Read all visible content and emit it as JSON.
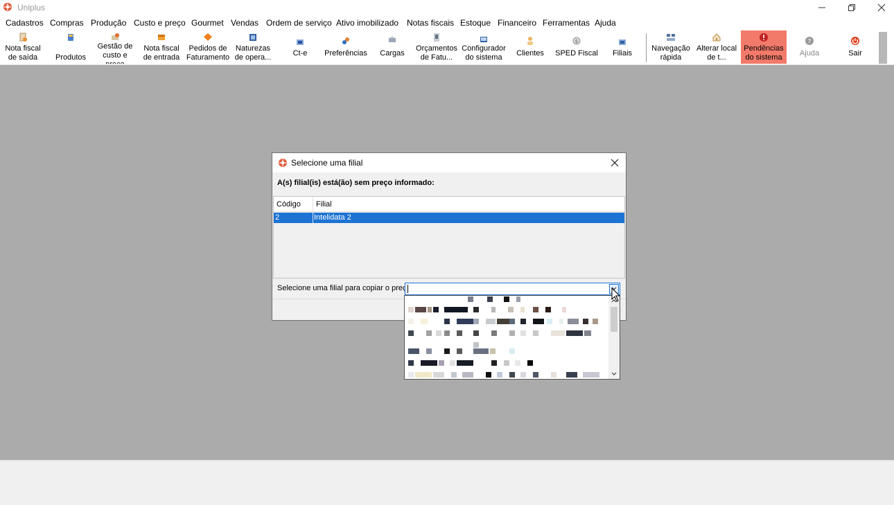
{
  "window": {
    "title": "Uniplus",
    "logo_icon": "uniplus-logo-icon",
    "controls": [
      "minimize-icon",
      "restore-icon",
      "close-icon"
    ]
  },
  "menu": [
    "Cadastros",
    "Compras",
    "Produção",
    "Custo e preço",
    "Gourmet",
    "Vendas",
    "Ordem de serviço",
    "Ativo imobilizado",
    "Notas fiscais",
    "Estoque",
    "Financeiro",
    "Ferramentas",
    "Ajuda"
  ],
  "toolbar": [
    {
      "label": "Nota fiscal\nde saída",
      "icon": "invoice-out-icon"
    },
    {
      "label": "Produtos",
      "icon": "products-icon"
    },
    {
      "label": "Gestão de\ncusto e\npreço",
      "icon": "cost-price-icon"
    },
    {
      "label": "Nota fiscal\nde entrada",
      "icon": "invoice-in-icon"
    },
    {
      "label": "Pedidos de\nFaturamento",
      "icon": "billing-orders-icon"
    },
    {
      "label": "Naturezas\nde opera...",
      "icon": "operation-natures-icon"
    },
    {
      "label": "Ct-e",
      "icon": "cte-icon"
    },
    {
      "label": "Preferências",
      "icon": "preferences-icon"
    },
    {
      "label": "Cargas",
      "icon": "cargo-icon"
    },
    {
      "label": "Orçamentos\nde Fatu...",
      "icon": "billing-quotes-icon"
    },
    {
      "label": "Configurador\ndo sistema",
      "icon": "system-config-icon"
    },
    {
      "label": "Clientes",
      "icon": "clients-icon"
    },
    {
      "label": "SPED Fiscal",
      "icon": "sped-icon"
    },
    {
      "label": "Filiais",
      "icon": "branches-icon"
    },
    {
      "label": "Navegação\nrápida",
      "icon": "quick-nav-icon"
    },
    {
      "label": "Alterar local\nde t...",
      "icon": "change-location-icon"
    },
    {
      "label": "Pendências\ndo sistema",
      "icon": "alert-icon",
      "highlight": "#f27a6a"
    },
    {
      "label": "Ajuda",
      "icon": "help-icon",
      "disabled": true
    },
    {
      "label": "Sair",
      "icon": "power-icon"
    }
  ],
  "dialog": {
    "title": "Selecione uma filial",
    "message": "A(s) filial(is) está(ão) sem preço informado:",
    "columns": [
      "Código",
      "Filial"
    ],
    "rows": [
      {
        "codigo": "2",
        "filial": "Intelidata 2",
        "selected": true
      }
    ],
    "select_label": "Selecione uma filial para copiar o preço:",
    "select_value": "",
    "accent": "#1c73d3"
  }
}
